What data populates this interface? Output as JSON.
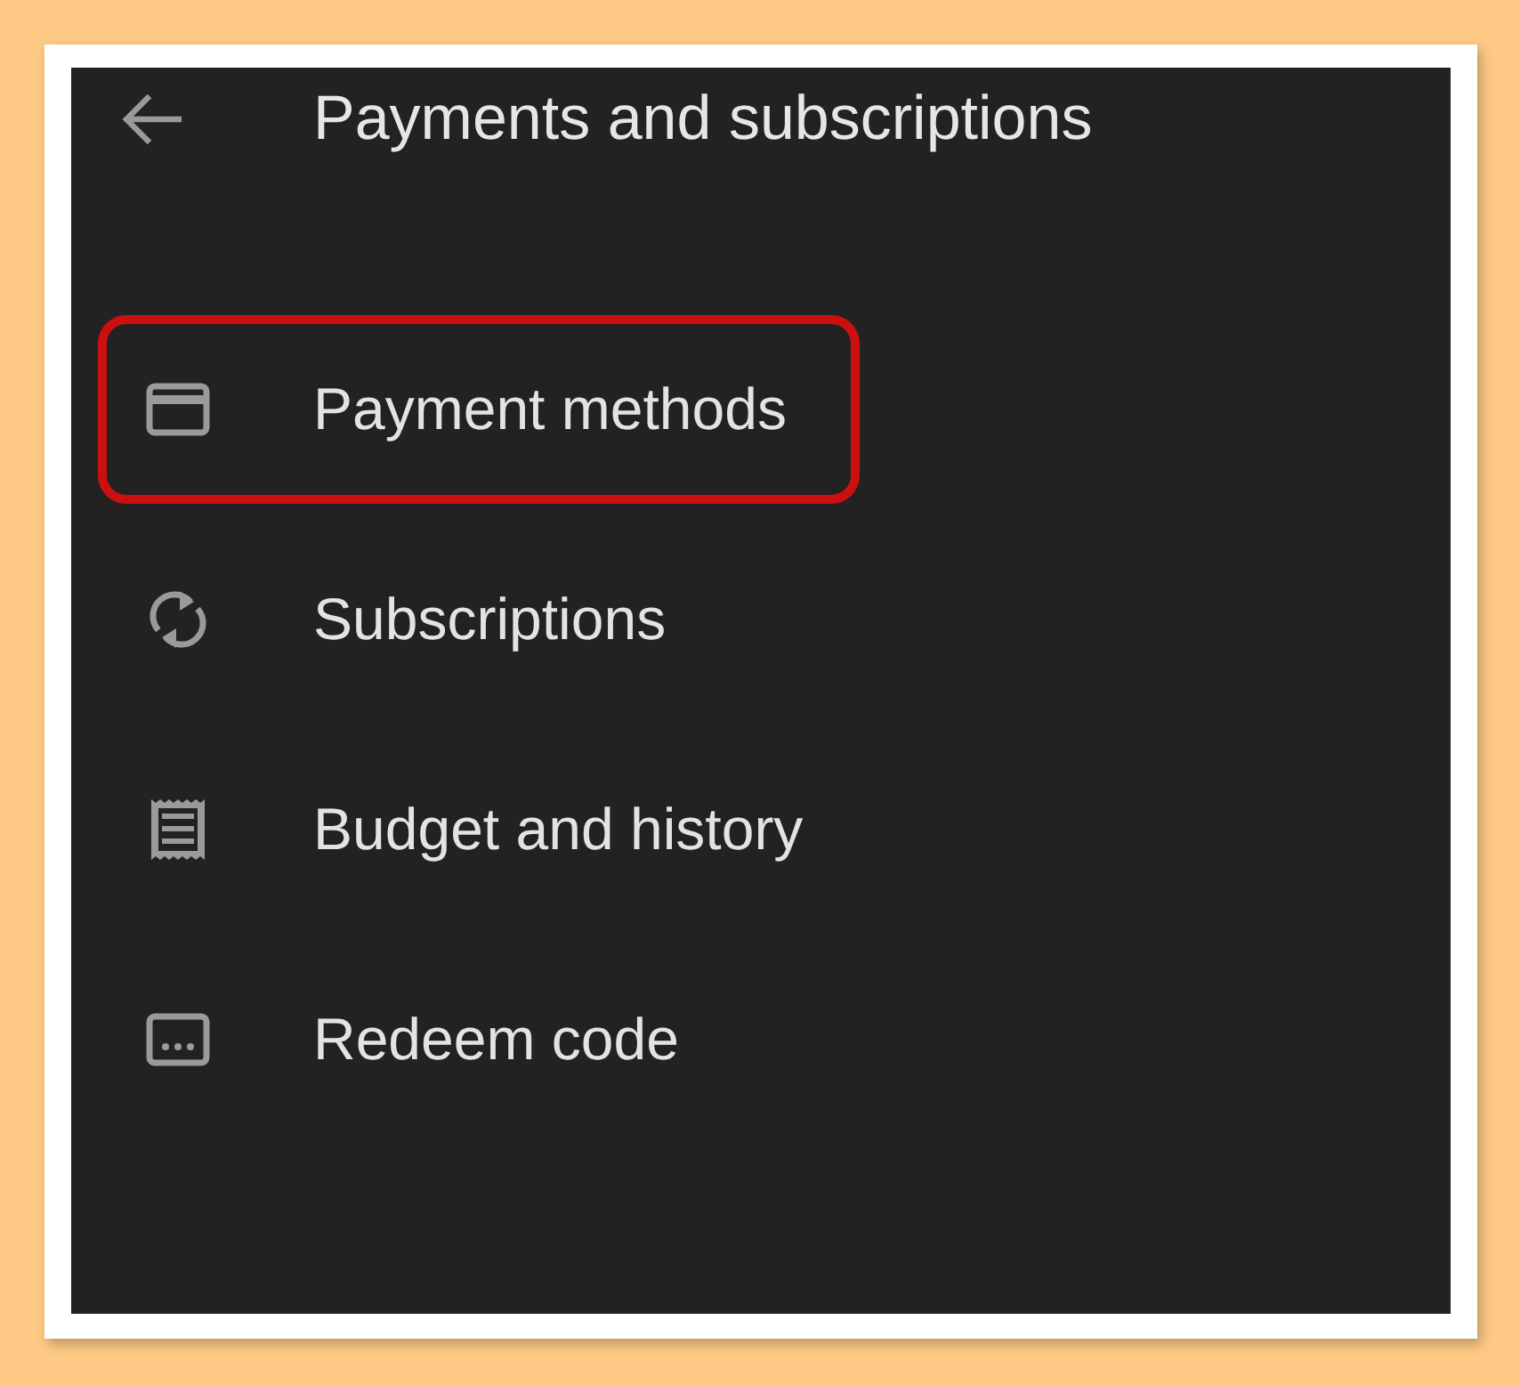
{
  "header": {
    "title": "Payments and subscriptions"
  },
  "items": [
    {
      "label": "Payment methods",
      "kind": "card",
      "highlighted": true
    },
    {
      "label": "Subscriptions",
      "kind": "sync",
      "highlighted": false
    },
    {
      "label": "Budget and history",
      "kind": "receipt",
      "highlighted": false
    },
    {
      "label": "Redeem code",
      "kind": "code",
      "highlighted": false
    }
  ]
}
